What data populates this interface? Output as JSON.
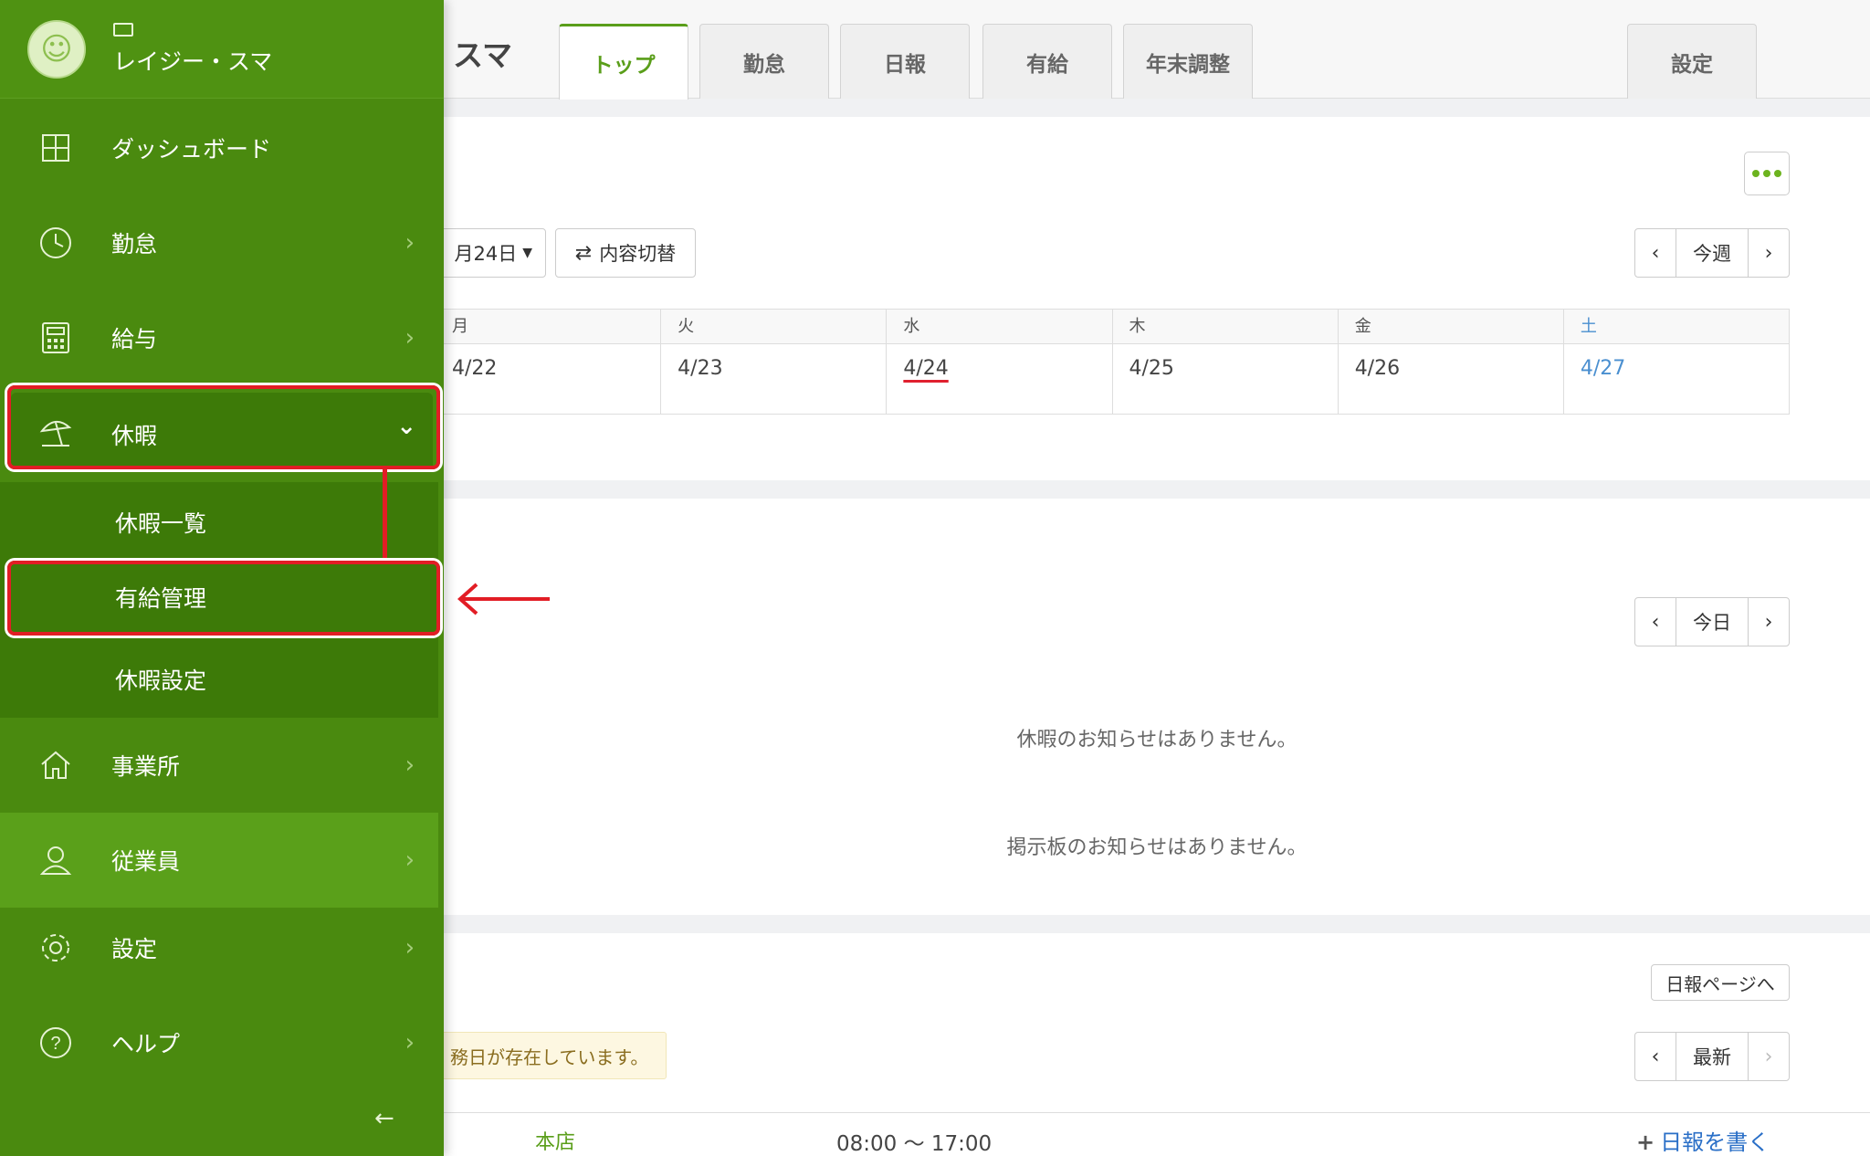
{
  "colors": {
    "sidebar": "#4a8a0f",
    "accent": "#5a9e1a",
    "annotation": "#e21d25",
    "saturday": "#4a8fd0"
  },
  "header": {
    "brand_fragment": "スマ",
    "tabs": [
      {
        "label": "トップ",
        "active": true
      },
      {
        "label": "勤怠"
      },
      {
        "label": "日報"
      },
      {
        "label": "有給"
      },
      {
        "label": "年末調整"
      },
      {
        "label": "設定"
      }
    ]
  },
  "week_panel": {
    "date_dropdown": "月24日",
    "toggle_button": "内容切替",
    "pager": {
      "prev": "‹",
      "label": "今週",
      "next": "›"
    },
    "calendar": {
      "days": [
        "月",
        "火",
        "水",
        "木",
        "金",
        "土"
      ],
      "dates": [
        "4/22",
        "4/23",
        "4/24",
        "4/25",
        "4/26",
        "4/27"
      ]
    }
  },
  "notice_panel": {
    "pager": {
      "prev": "‹",
      "label": "今日",
      "next": "›"
    },
    "leave_message": "休暇のお知らせはありません。",
    "board_message": "掲示板のお知らせはありません。"
  },
  "report_panel": {
    "page_link": "日報ページへ",
    "pager": {
      "prev": "‹",
      "label": "最新",
      "next": "›"
    },
    "notice": "務日が存在しています。",
    "row": {
      "store": "本店",
      "hours": "08:00 ～ 17:00",
      "write_link": "日報を書く"
    }
  },
  "sidebar": {
    "user_name": "レイジー・スマ",
    "items": [
      {
        "label": "ダッシュボード",
        "icon": "dashboard-icon"
      },
      {
        "label": "勤怠",
        "icon": "clock-icon"
      },
      {
        "label": "給与",
        "icon": "calculator-icon"
      },
      {
        "label": "休暇",
        "icon": "beach-umbrella-icon"
      },
      {
        "label": "事業所",
        "icon": "home-icon"
      },
      {
        "label": "従業員",
        "icon": "person-icon"
      },
      {
        "label": "設定",
        "icon": "gear-icon"
      },
      {
        "label": "ヘルプ",
        "icon": "help-icon"
      }
    ],
    "leave_sub": [
      {
        "label": "休暇一覧"
      },
      {
        "label": "有給管理"
      },
      {
        "label": "休暇設定"
      }
    ]
  }
}
